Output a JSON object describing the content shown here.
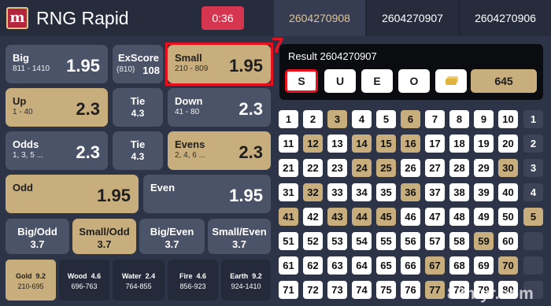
{
  "header": {
    "logo_glyph": "m",
    "title": "RNG Rapid",
    "timer": "0:36",
    "tabs": [
      "2604270908",
      "2604270907",
      "2604270906"
    ]
  },
  "bets": {
    "big": {
      "label": "Big",
      "range": "811 - 1410",
      "odds": "1.95"
    },
    "exscore": {
      "label": "ExScore",
      "sub": "(810)",
      "odds": "108"
    },
    "small": {
      "label": "Small",
      "range": "210 - 809",
      "odds": "1.95"
    },
    "up": {
      "label": "Up",
      "range": "1 - 40",
      "odds": "2.3"
    },
    "tie1": {
      "label": "Tie",
      "odds": "4.3"
    },
    "down": {
      "label": "Down",
      "range": "41 - 80",
      "odds": "2.3"
    },
    "odds": {
      "label": "Odds",
      "range": "1, 3, 5 ...",
      "odds": "2.3"
    },
    "tie2": {
      "label": "Tie",
      "odds": "4.3"
    },
    "evens": {
      "label": "Evens",
      "range": "2, 4, 6 ...",
      "odds": "2.3"
    },
    "odd": {
      "label": "Odd",
      "odds": "1.95"
    },
    "even": {
      "label": "Even",
      "odds": "1.95"
    },
    "big_odd": {
      "label": "Big/Odd",
      "odds": "3.7"
    },
    "small_odd": {
      "label": "Small/Odd",
      "odds": "3.7"
    },
    "big_even": {
      "label": "Big/Even",
      "odds": "3.7"
    },
    "small_even": {
      "label": "Small/Even",
      "odds": "3.7"
    }
  },
  "elements": [
    {
      "name": "Gold",
      "odds": "9.2",
      "range": "210-695"
    },
    {
      "name": "Wood",
      "odds": "4.6",
      "range": "696-763"
    },
    {
      "name": "Water",
      "odds": "2.4",
      "range": "764-855"
    },
    {
      "name": "Fire",
      "odds": "4.6",
      "range": "856-923"
    },
    {
      "name": "Earth",
      "odds": "9.2",
      "range": "924-1410"
    }
  ],
  "annotation": "7",
  "result": {
    "label": "Result  2604270907",
    "buttons": [
      "S",
      "U",
      "E",
      "O"
    ],
    "total": "645"
  },
  "grid_rows": [
    {
      "cells": [
        [
          "1",
          0
        ],
        [
          "2",
          0
        ],
        [
          "3",
          1
        ],
        [
          "4",
          0
        ],
        [
          "5",
          0
        ],
        [
          "6",
          1
        ],
        [
          "7",
          0
        ],
        [
          "8",
          0
        ],
        [
          "9",
          0
        ],
        [
          "10",
          0
        ]
      ],
      "sum": [
        "1",
        0
      ]
    },
    {
      "cells": [
        [
          "11",
          0
        ],
        [
          "12",
          1
        ],
        [
          "13",
          0
        ],
        [
          "14",
          1
        ],
        [
          "15",
          1
        ],
        [
          "16",
          1
        ],
        [
          "17",
          0
        ],
        [
          "18",
          0
        ],
        [
          "19",
          0
        ],
        [
          "20",
          0
        ]
      ],
      "sum": [
        "2",
        0
      ]
    },
    {
      "cells": [
        [
          "21",
          0
        ],
        [
          "22",
          0
        ],
        [
          "23",
          0
        ],
        [
          "24",
          1
        ],
        [
          "25",
          1
        ],
        [
          "26",
          0
        ],
        [
          "27",
          0
        ],
        [
          "28",
          0
        ],
        [
          "29",
          0
        ],
        [
          "30",
          1
        ]
      ],
      "sum": [
        "3",
        0
      ]
    },
    {
      "cells": [
        [
          "31",
          0
        ],
        [
          "32",
          1
        ],
        [
          "33",
          0
        ],
        [
          "34",
          0
        ],
        [
          "35",
          0
        ],
        [
          "36",
          1
        ],
        [
          "37",
          0
        ],
        [
          "38",
          0
        ],
        [
          "39",
          0
        ],
        [
          "40",
          0
        ]
      ],
      "sum": [
        "4",
        0
      ]
    },
    {
      "cells": [
        [
          "41",
          1
        ],
        [
          "42",
          0
        ],
        [
          "43",
          1
        ],
        [
          "44",
          1
        ],
        [
          "45",
          1
        ],
        [
          "46",
          0
        ],
        [
          "47",
          0
        ],
        [
          "48",
          0
        ],
        [
          "49",
          0
        ],
        [
          "50",
          0
        ]
      ],
      "sum": [
        "5",
        1
      ]
    },
    {
      "cells": [
        [
          "51",
          0
        ],
        [
          "52",
          0
        ],
        [
          "53",
          0
        ],
        [
          "54",
          0
        ],
        [
          "55",
          0
        ],
        [
          "56",
          0
        ],
        [
          "57",
          0
        ],
        [
          "58",
          0
        ],
        [
          "59",
          1
        ],
        [
          "60",
          0
        ]
      ],
      "sum": [
        "",
        0
      ]
    },
    {
      "cells": [
        [
          "61",
          0
        ],
        [
          "62",
          0
        ],
        [
          "63",
          0
        ],
        [
          "64",
          0
        ],
        [
          "65",
          0
        ],
        [
          "66",
          0
        ],
        [
          "67",
          1
        ],
        [
          "68",
          0
        ],
        [
          "69",
          0
        ],
        [
          "70",
          1
        ]
      ],
      "sum": [
        "",
        0
      ]
    },
    {
      "cells": [
        [
          "71",
          0
        ],
        [
          "72",
          0
        ],
        [
          "73",
          0
        ],
        [
          "74",
          0
        ],
        [
          "75",
          0
        ],
        [
          "76",
          0
        ],
        [
          "77",
          1
        ],
        [
          "78",
          0
        ],
        [
          "79",
          0
        ],
        [
          "80",
          0
        ]
      ],
      "sum": [
        "",
        0
      ]
    }
  ],
  "watermark": "88myr.com",
  "colors": {
    "accent_gold": "#c9ae7d",
    "timer_red": "#d5354e",
    "highlight_red": "#e8121f"
  }
}
